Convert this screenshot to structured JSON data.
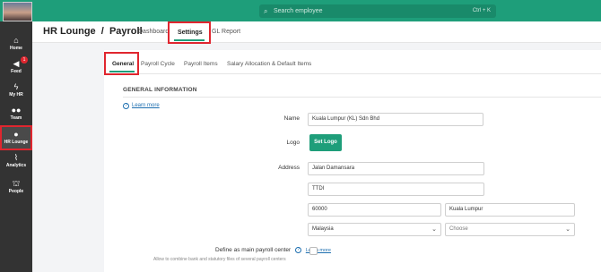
{
  "topbar": {
    "search_placeholder": "Search employee",
    "search_shortcut": "Ctrl + K"
  },
  "sidebar": {
    "items": [
      {
        "label": "Home",
        "icon": "home-icon",
        "glyph": "⌂"
      },
      {
        "label": "Feed",
        "icon": "megaphone-icon",
        "glyph": "📢",
        "badge": "1"
      },
      {
        "label": "My HR",
        "icon": "lightning-icon",
        "glyph": "ϟ"
      },
      {
        "label": "Team",
        "icon": "team-icon",
        "glyph": "👥"
      },
      {
        "label": "HR Lounge",
        "icon": "user-gear-icon",
        "glyph": "👤",
        "active": true
      },
      {
        "label": "Analytics",
        "icon": "chart-icon",
        "glyph": "📈"
      },
      {
        "label": "People",
        "icon": "org-chart-icon",
        "glyph": "⛫"
      }
    ]
  },
  "header": {
    "breadcrumb": "HR Lounge  /  Payroll",
    "tabs": [
      "Dashboard",
      "Settings",
      "GL Report"
    ],
    "active_tab": "Settings"
  },
  "subtabs": {
    "items": [
      "General",
      "Payroll Cycle",
      "Payroll Items",
      "Salary Allocation & Default Items"
    ],
    "active": "General"
  },
  "general": {
    "section_title": "GENERAL INFORMATION",
    "learn_more": "Learn more",
    "name_label": "Name",
    "name_value": "Kuala Lumpur (KL) Sdn Bhd",
    "logo_label": "Logo",
    "set_logo_button": "Set Logo",
    "address_label": "Address",
    "address_line1": "Jalan Damansara",
    "address_line2": "TTDI",
    "postcode": "60000",
    "city": "Kuala Lumpur",
    "country": "Malaysia",
    "state_placeholder": "Choose",
    "main_payroll_label": "Define as main payroll center",
    "main_payroll_learn_more": "Learn more",
    "main_payroll_hint": "Allow to combine bank and statutory files of several payroll centers",
    "main_payroll_checked": false
  },
  "colors": {
    "brand": "#1e9e7a",
    "highlight": "#e0262f",
    "sidebar_bg": "#333333"
  }
}
